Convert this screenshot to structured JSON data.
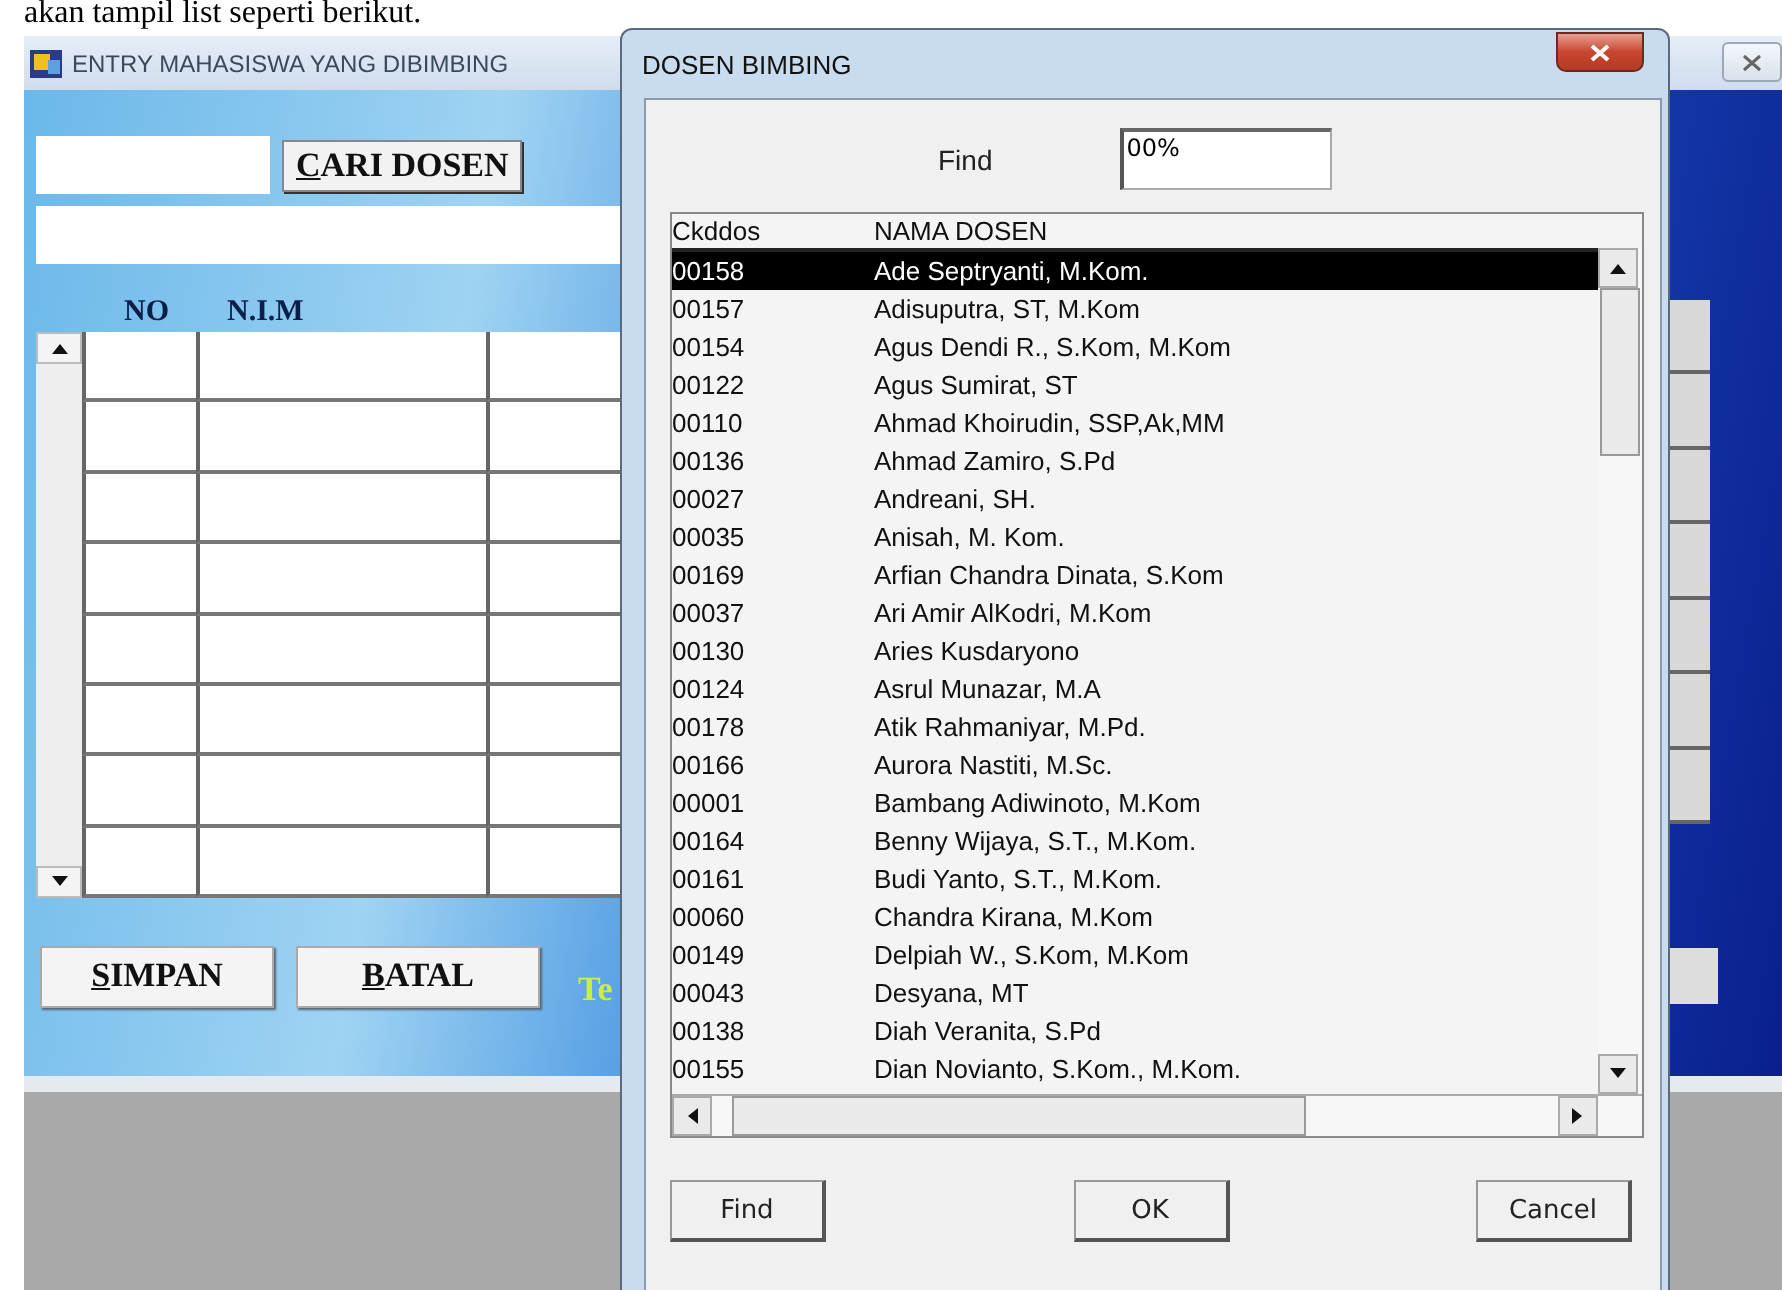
{
  "document_text": "akan tampil list seperti berikut.",
  "main_window": {
    "title": "ENTRY MAHASISWA YANG DIBIMBING",
    "search_button": {
      "accel": "C",
      "rest": "ARI DOSEN"
    },
    "grid": {
      "columns": [
        "NO",
        "N.I.M"
      ]
    },
    "buttons": [
      {
        "accel": "S",
        "rest": "IMPAN"
      },
      {
        "accel": "B",
        "rest": "ATAL"
      }
    ],
    "partial_label": "Te"
  },
  "dialog": {
    "title": "DOSEN BIMBING",
    "find_label": "Find",
    "find_value": "00%",
    "list": {
      "columns": [
        "Ckddos",
        "NAMA DOSEN"
      ],
      "rows": [
        {
          "code": "00158",
          "name": "Ade Septryanti, M.Kom.",
          "selected": true
        },
        {
          "code": "00157",
          "name": "Adisuputra, ST, M.Kom",
          "selected": false
        },
        {
          "code": "00154",
          "name": "Agus Dendi R., S.Kom, M.Kom",
          "selected": false
        },
        {
          "code": "00122",
          "name": "Agus Sumirat, ST",
          "selected": false
        },
        {
          "code": "00110",
          "name": "Ahmad Khoirudin, SSP,Ak,MM",
          "selected": false
        },
        {
          "code": "00136",
          "name": "Ahmad Zamiro, S.Pd",
          "selected": false
        },
        {
          "code": "00027",
          "name": "Andreani, SH.",
          "selected": false
        },
        {
          "code": "00035",
          "name": "Anisah, M. Kom.",
          "selected": false
        },
        {
          "code": "00169",
          "name": "Arfian Chandra Dinata, S.Kom",
          "selected": false
        },
        {
          "code": "00037",
          "name": "Ari Amir AlKodri, M.Kom",
          "selected": false
        },
        {
          "code": "00130",
          "name": "Aries Kusdaryono",
          "selected": false
        },
        {
          "code": "00124",
          "name": "Asrul Munazar, M.A",
          "selected": false
        },
        {
          "code": "00178",
          "name": "Atik Rahmaniyar, M.Pd.",
          "selected": false
        },
        {
          "code": "00166",
          "name": "Aurora Nastiti, M.Sc.",
          "selected": false
        },
        {
          "code": "00001",
          "name": "Bambang Adiwinoto, M.Kom",
          "selected": false
        },
        {
          "code": "00164",
          "name": "Benny Wijaya, S.T., M.Kom.",
          "selected": false
        },
        {
          "code": "00161",
          "name": "Budi Yanto, S.T., M.Kom.",
          "selected": false
        },
        {
          "code": "00060",
          "name": "Chandra Kirana, M.Kom",
          "selected": false
        },
        {
          "code": "00149",
          "name": "Delpiah W., S.Kom, M.Kom",
          "selected": false
        },
        {
          "code": "00043",
          "name": "Desyana, MT",
          "selected": false
        },
        {
          "code": "00138",
          "name": "Diah Veranita, S.Pd",
          "selected": false
        },
        {
          "code": "00155",
          "name": "Dian Novianto, S.Kom., M.Kom.",
          "selected": false
        }
      ]
    },
    "buttons": [
      "Find",
      "OK",
      "Cancel"
    ]
  }
}
